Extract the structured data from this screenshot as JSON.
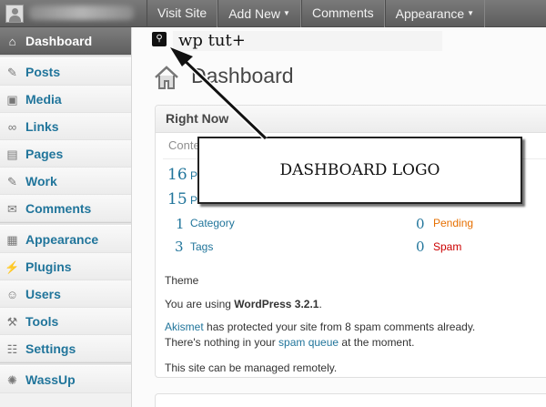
{
  "topbar": {
    "items": [
      "Visit Site",
      "Add New",
      "Comments",
      "Appearance"
    ]
  },
  "sidebar": {
    "items": [
      {
        "label": "Dashboard",
        "icon": "home-icon"
      },
      {
        "label": "Posts",
        "icon": "pushpin-icon"
      },
      {
        "label": "Media",
        "icon": "media-icon"
      },
      {
        "label": "Links",
        "icon": "link-icon"
      },
      {
        "label": "Pages",
        "icon": "pages-icon"
      },
      {
        "label": "Work",
        "icon": "pushpin-icon"
      },
      {
        "label": "Comments",
        "icon": "comments-icon"
      },
      {
        "label": "Appearance",
        "icon": "appearance-icon"
      },
      {
        "label": "Plugins",
        "icon": "plugins-icon"
      },
      {
        "label": "Users",
        "icon": "users-icon"
      },
      {
        "label": "Tools",
        "icon": "tools-icon"
      },
      {
        "label": "Settings",
        "icon": "settings-icon"
      },
      {
        "label": "WassUp",
        "icon": "wassup-icon"
      }
    ]
  },
  "header": {
    "site_name": "wp tut+",
    "page_title": "Dashboard"
  },
  "right_now": {
    "title": "Right Now",
    "content_label": "Conte",
    "stats": [
      {
        "num": "16",
        "label": "P"
      },
      {
        "num": "15",
        "label": "P"
      },
      {
        "num": "1",
        "label": "Category"
      },
      {
        "num": "3",
        "label": "Tags"
      }
    ],
    "discussion": [
      {
        "num": "0",
        "label": "Pending"
      },
      {
        "num": "0",
        "label": "Spam"
      }
    ],
    "theme_label": "Theme",
    "version_prefix": "You are using ",
    "version_name": "WordPress 3.2.1",
    "version_suffix": ".",
    "akismet_link": "Akismet",
    "akismet_text": " has protected your site from 8 spam comments already.",
    "queue_prefix": "There's nothing in your ",
    "queue_link": "spam queue",
    "queue_suffix": " at the moment.",
    "remote_text": "This site can be managed remotely."
  },
  "callout": {
    "text": "DASHBOARD LOGO"
  },
  "colors": {
    "link": "#21759b",
    "pending": "#e66f00",
    "spam": "#cc0000",
    "adminbar": "#5d5d5d"
  }
}
